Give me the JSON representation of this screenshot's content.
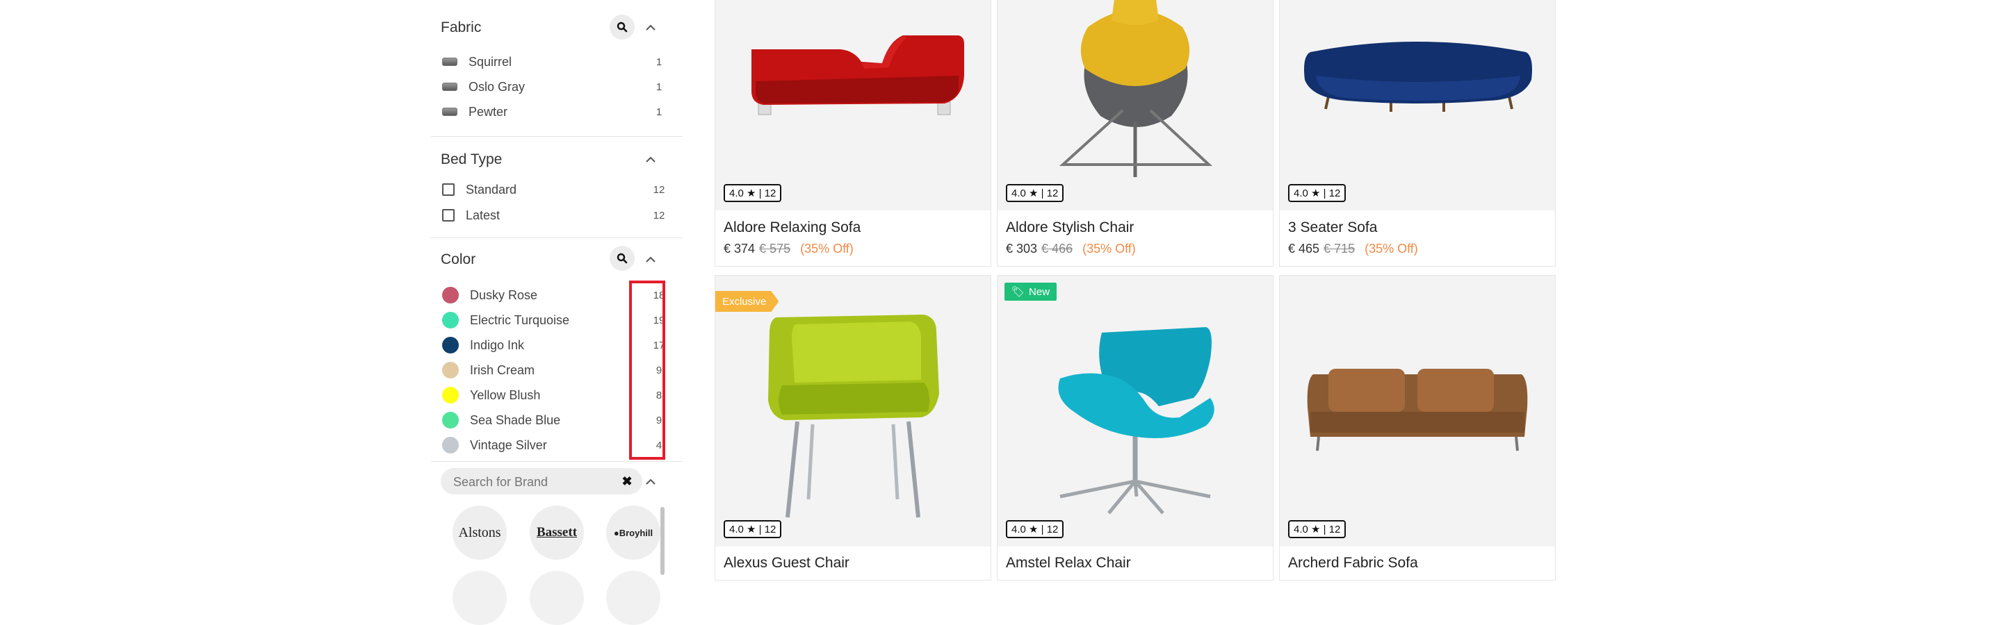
{
  "filters": {
    "fabric": {
      "title": "Fabric",
      "items": [
        {
          "label": "Squirrel",
          "count": "1"
        },
        {
          "label": "Oslo Gray",
          "count": "1"
        },
        {
          "label": "Pewter",
          "count": "1"
        }
      ]
    },
    "bed_type": {
      "title": "Bed Type",
      "items": [
        {
          "label": "Standard",
          "count": "12"
        },
        {
          "label": "Latest",
          "count": "12"
        }
      ]
    },
    "color": {
      "title": "Color",
      "items": [
        {
          "label": "Dusky Rose",
          "count": "18",
          "color": "#c5566c"
        },
        {
          "label": "Electric Turquoise",
          "count": "19",
          "color": "#3fe0b0"
        },
        {
          "label": "Indigo Ink",
          "count": "17",
          "color": "#0f3f6b"
        },
        {
          "label": "Irish Cream",
          "count": "9",
          "color": "#e3c9a2"
        },
        {
          "label": "Yellow Blush",
          "count": "8",
          "color": "#ffff14"
        },
        {
          "label": "Sea Shade Blue",
          "count": "9",
          "color": "#4fe39a"
        },
        {
          "label": "Vintage Silver",
          "count": "4",
          "color": "#c4c8cf"
        }
      ]
    },
    "brand": {
      "placeholder": "Search for Brand",
      "clear": "✖",
      "logos": [
        "Alstons",
        "Bassett",
        "●Broyhill"
      ]
    }
  },
  "products": [
    {
      "name": "Aldore Relaxing Sofa",
      "rating": "4.0 ★ | 12",
      "price": "€ 374",
      "old_price": "€ 575",
      "discount": "(35% Off)"
    },
    {
      "name": "Aldore Stylish Chair",
      "rating": "4.0 ★ | 12",
      "price": "€ 303",
      "old_price": "€ 466",
      "discount": "(35% Off)"
    },
    {
      "name": "3 Seater Sofa",
      "rating": "4.0 ★ | 12",
      "price": "€ 465",
      "old_price": "€ 715",
      "discount": "(35% Off)"
    },
    {
      "name": "Alexus Guest Chair",
      "rating": "4.0 ★ | 12",
      "tag": "Exclusive"
    },
    {
      "name": "Amstel Relax Chair",
      "rating": "4.0 ★ | 12",
      "tag": "New"
    },
    {
      "name": "Archerd Fabric Sofa",
      "rating": "4.0 ★ | 12"
    }
  ],
  "colors": {
    "accent_orange": "#f08a45",
    "highlight_red": "#e41d2b",
    "exclusive_tag": "#f7b53c",
    "new_tag": "#1fbf7a"
  }
}
